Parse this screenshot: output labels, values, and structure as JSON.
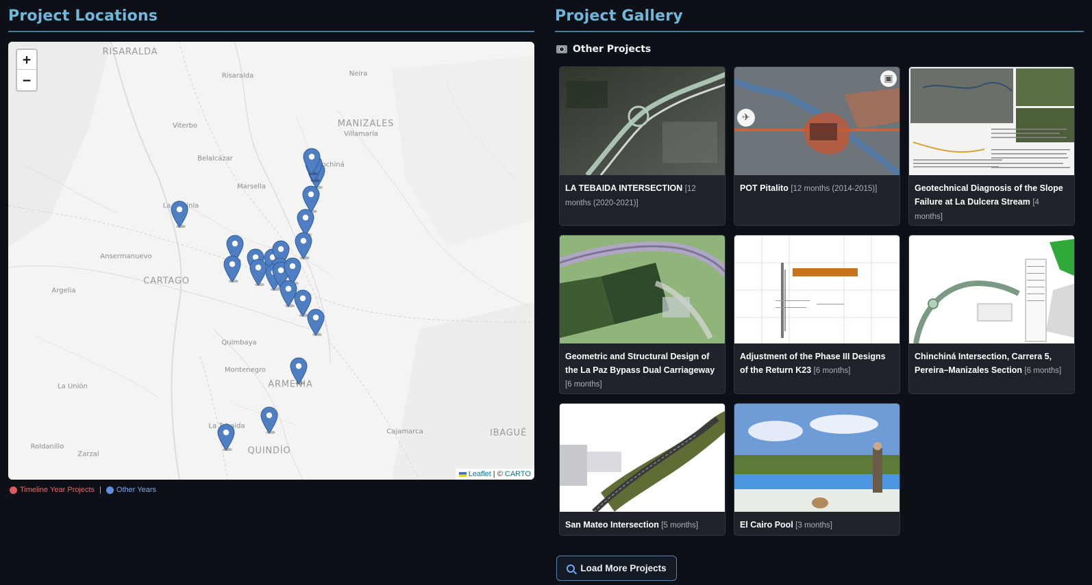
{
  "locations": {
    "title": "Project Locations",
    "zoom_in": "+",
    "zoom_out": "−",
    "attribution": {
      "leaflet": "Leaflet",
      "sep": " | © ",
      "carto": "CARTO"
    },
    "places": [
      {
        "name": "RISARALDA",
        "big": true
      },
      {
        "name": "Risaralda"
      },
      {
        "name": "Neira"
      },
      {
        "name": "MANIZALES",
        "big": true
      },
      {
        "name": "Villamaría"
      },
      {
        "name": "Viterbo"
      },
      {
        "name": "Belalcázar"
      },
      {
        "name": "Marsella"
      },
      {
        "name": "La Virginia"
      },
      {
        "name": "Ansermanuevo"
      },
      {
        "name": "CARTAGO",
        "big": true
      },
      {
        "name": "Argelia"
      },
      {
        "name": "Quimbaya"
      },
      {
        "name": "Montenegro"
      },
      {
        "name": "La Unión"
      },
      {
        "name": "La Tebaida"
      },
      {
        "name": "Cajamarca"
      },
      {
        "name": "IBAGUÉ",
        "big": true
      },
      {
        "name": "QUINDÍO",
        "big": true
      },
      {
        "name": "Roldanillo"
      },
      {
        "name": "Zarzal"
      },
      {
        "name": "ARMENIA",
        "big": true
      },
      {
        "name": "Chinchiná"
      }
    ],
    "marker_count": 23,
    "legend": {
      "timeline": "Timeline Year Projects",
      "separator": "|",
      "other": "Other Years"
    },
    "colors": {
      "timeline": "#d95b5b",
      "other": "#5d8fd8",
      "marker": "#4f7fc2"
    }
  },
  "gallery": {
    "title": "Project Gallery",
    "subheading": "Other Projects",
    "cards": [
      {
        "title": "LA TEBAIDA INTERSECTION",
        "duration": "[12 months (2020-2021)]",
        "thumb": "aerial-interchange"
      },
      {
        "title": "POT Pitalito",
        "duration": "[12 months (2014-2015)]",
        "thumb": "satellite-map"
      },
      {
        "title": "Geotechnical Diagnosis of the Slope Failure at La Dulcera Stream",
        "duration": "[4 months]",
        "thumb": "report-collage"
      },
      {
        "title": "Geometric and Structural Design of the La Paz Bypass Dual Carriageway",
        "duration": "[6 months]",
        "thumb": "road-render"
      },
      {
        "title": "Adjustment of the Phase III Designs of the Return K23",
        "duration": "[6 months]",
        "thumb": "profile-drawing"
      },
      {
        "title": "Chinchiná Intersection, Carrera 5, Pereira–Manizales Section",
        "duration": "[6 months]",
        "thumb": "plan-drawing"
      },
      {
        "title": "San Mateo Intersection",
        "duration": "[5 months]",
        "thumb": "3d-road-model"
      },
      {
        "title": "El Cairo Pool",
        "duration": "[3 months]",
        "thumb": "pool-photo"
      }
    ],
    "load_more": "Load More Projects"
  }
}
